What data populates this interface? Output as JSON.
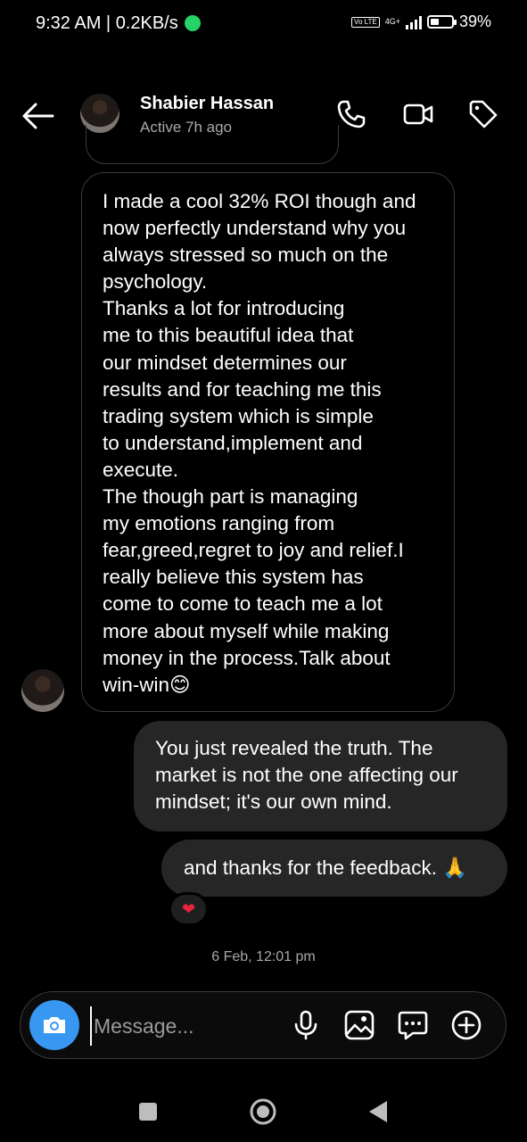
{
  "status_bar": {
    "time": "9:32 AM | 0.2KB/s",
    "volte": "Vo LTE",
    "network": "4G+",
    "battery": "39%",
    "battery_level": 0.39
  },
  "header": {
    "name": "Shabier Hassan",
    "status": "Active 7h ago"
  },
  "messages": [
    {
      "direction": "incoming",
      "text": "I made a cool 32% ROI though and now perfectly understand why you always stressed so much on the psychology.\nThanks a lot for introducing\nme to this beautiful idea that\nour mindset determines our\nresults and for teaching me this\ntrading system which is simple\nto understand,implement and\nexecute.\n  The though part is managing\nmy emotions ranging from\nfear,greed,regret to joy and relief.I really believe this system has\ncome to come to teach me a lot\nmore about myself while making\nmoney in the process.Talk about\nwin-win😊"
    },
    {
      "direction": "outgoing",
      "text": "You just revealed the truth. The market is not the one affecting our mindset; it's our own mind."
    },
    {
      "direction": "outgoing",
      "text": "and thanks for the feedback. 🙏",
      "reaction": "❤"
    }
  ],
  "timestamp": "6 Feb, 12:01 pm",
  "composer": {
    "placeholder": "Message..."
  },
  "icons": {
    "back": "back-arrow-icon",
    "call": "phone-icon",
    "video": "video-call-icon",
    "tag": "tag-icon",
    "camera": "camera-icon",
    "mic": "microphone-icon",
    "gallery": "gallery-icon",
    "sticker": "sticker-icon",
    "add": "plus-icon"
  },
  "colors": {
    "background": "#000000",
    "outgoing_bubble": "#262626",
    "accent": "#3897f0",
    "secondary_text": "#a8a8a8"
  }
}
